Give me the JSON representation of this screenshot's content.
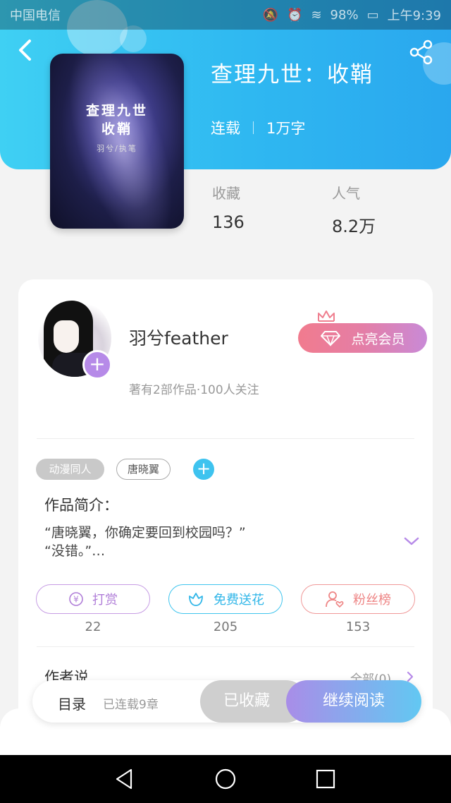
{
  "status_bar": {
    "carrier": "中国电信",
    "battery": "98%",
    "time": "上午9:39"
  },
  "book": {
    "title": "查理九世：收鞘",
    "status": "连载",
    "word_count": "1万字",
    "cover_title_line1": "查理九世",
    "cover_title_line2": "收鞘",
    "cover_subtitle": "羽兮/执笔"
  },
  "stats": {
    "favorites_label": "收藏",
    "favorites_value": "136",
    "popularity_label": "人气",
    "popularity_value": "8.2万"
  },
  "author": {
    "name": "羽兮feather",
    "summary": "著有2部作品·100人关注",
    "vip_button": "点亮会员"
  },
  "tags": [
    "动漫同人",
    "唐晓翼"
  ],
  "intro": {
    "heading": "作品简介：",
    "line1": "“唐晓翼，你确定要回到校园吗？”",
    "line2": "“没错。”…"
  },
  "actions": {
    "tip_label": "打赏",
    "tip_count": "22",
    "flower_label": "免费送花",
    "flower_count": "205",
    "fans_label": "粉丝榜",
    "fans_count": "153"
  },
  "author_says": {
    "heading": "作者说",
    "all_label": "全部(0)"
  },
  "bottom_bar": {
    "toc_label": "目录",
    "serial_info": "已连载9章",
    "collected_label": "已收藏",
    "read_label": "继续阅读"
  },
  "colors": {
    "header_blue": "#2fb8f1",
    "accent_purple": "#b68ae8",
    "accent_cyan": "#3ec3ef",
    "accent_pink": "#f17b8e"
  }
}
